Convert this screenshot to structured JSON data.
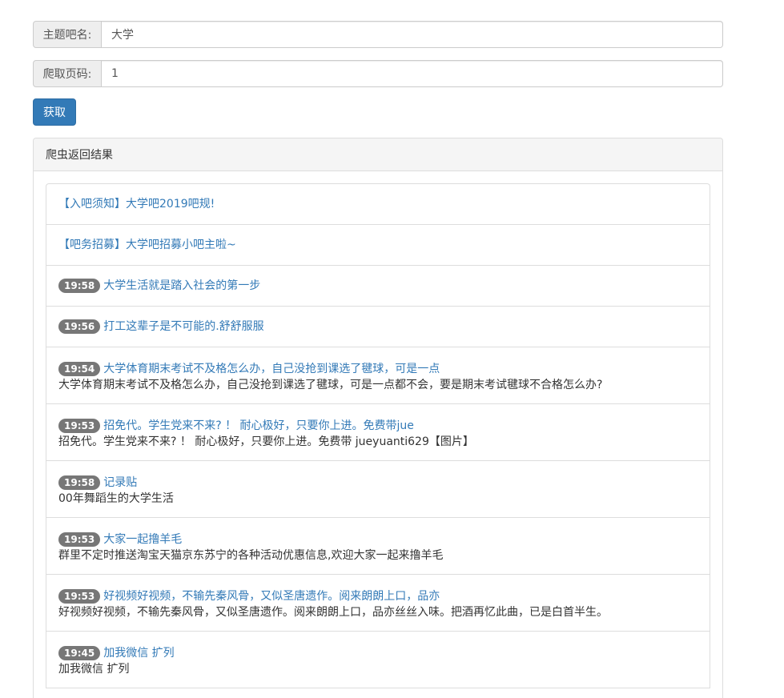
{
  "form": {
    "bar_name_label": "主题吧名:",
    "bar_name_value": "大学",
    "page_label": "爬取页码:",
    "page_value": "1",
    "fetch_button": "获取"
  },
  "panel": {
    "heading": "爬虫返回结果"
  },
  "posts": [
    {
      "time": "",
      "title": "【入吧须知】大学吧2019吧规!",
      "desc": ""
    },
    {
      "time": "",
      "title": "【吧务招募】大学吧招募小吧主啦~",
      "desc": ""
    },
    {
      "time": "19:58",
      "title": "大学生活就是踏入社会的第一步",
      "desc": ""
    },
    {
      "time": "19:56",
      "title": "打工这辈子是不可能的.舒舒服服",
      "desc": ""
    },
    {
      "time": "19:54",
      "title": "大学体育期末考试不及格怎么办，自己没抢到课选了毽球，可是一点",
      "desc": "大学体育期末考试不及格怎么办，自己没抢到课选了毽球，可是一点都不会，要是期末考试毽球不合格怎么办?"
    },
    {
      "time": "19:53",
      "title": "招免代。学生党来不来? ！ 耐心极好，只要你上进。免费带jue",
      "desc": "招免代。学生党来不来? ！ 耐心极好，只要你上进。免费带 jueyuanti629【图片】"
    },
    {
      "time": "19:58",
      "title": "记录贴",
      "desc": "00年舞蹈生的大学生活"
    },
    {
      "time": "19:53",
      "title": "大家一起撸羊毛",
      "desc": "群里不定时推送淘宝天猫京东苏宁的各种活动优惠信息,欢迎大家一起来撸羊毛"
    },
    {
      "time": "19:53",
      "title": "好视频好视频，不输先秦风骨，又似圣唐遗作。阅来朗朗上口，品亦",
      "desc": "好视频好视频，不输先秦风骨，又似圣唐遗作。阅来朗朗上口，品亦丝丝入味。把酒再忆此曲，已是白首半生。"
    },
    {
      "time": "19:45",
      "title": "加我微信 扩列",
      "desc": "加我微信 扩列"
    }
  ]
}
